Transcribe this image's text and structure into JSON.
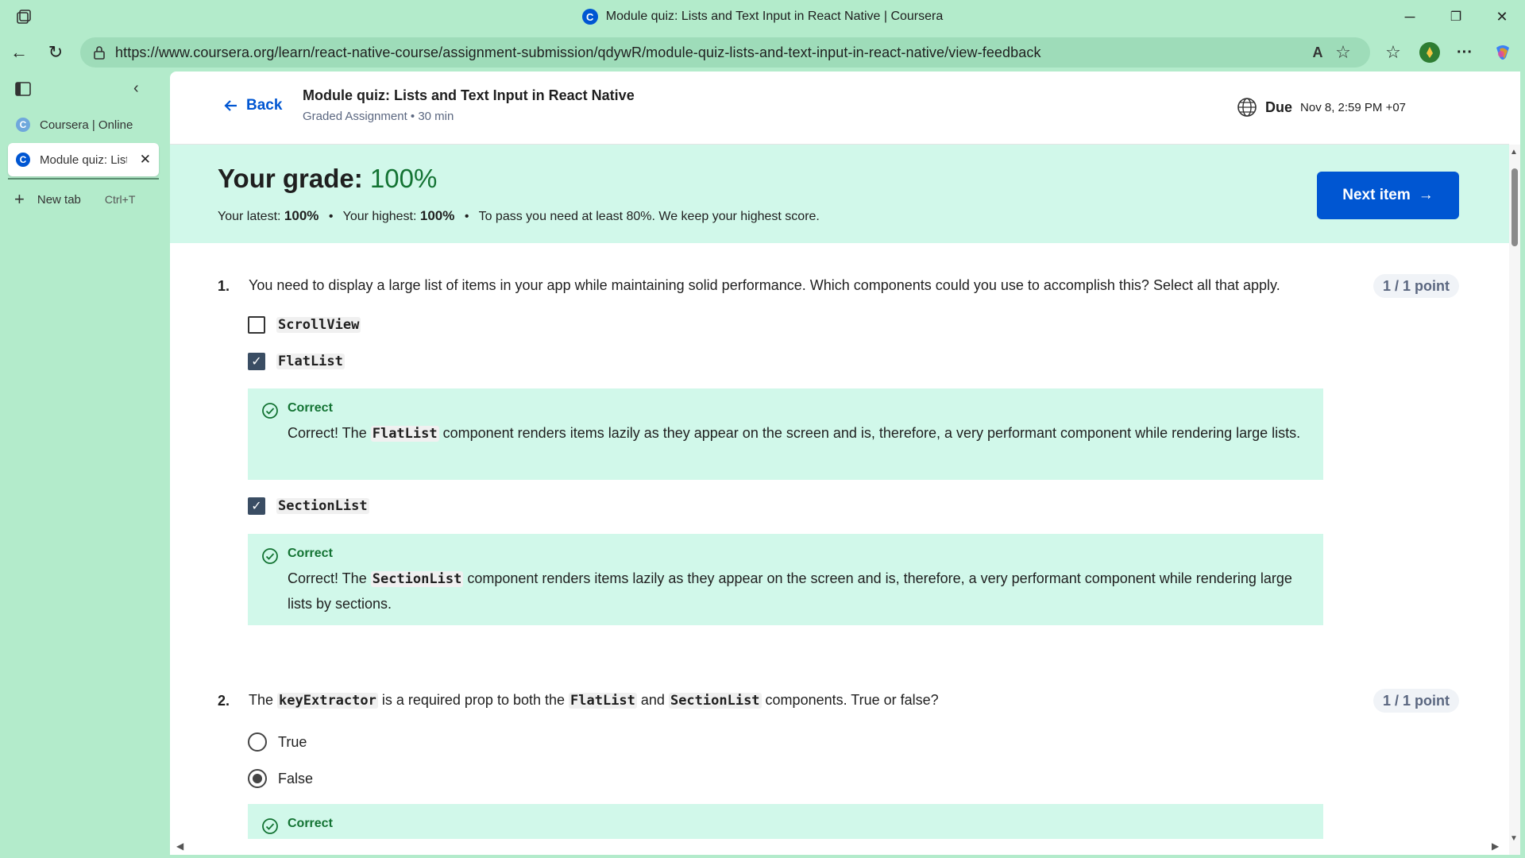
{
  "window": {
    "title": "Module quiz: Lists and Text Input in React Native | Coursera",
    "favicon_letter": "C",
    "controls": {
      "minimize": "─",
      "maximize": "❐",
      "close": "✕"
    }
  },
  "nav": {
    "back": "←",
    "reload": "↻",
    "url": "https://www.coursera.org/learn/react-native-course/assignment-submission/qdywR/module-quiz-lists-and-text-input-in-react-native/view-feedback",
    "read_aloud": "A",
    "favorite": "☆",
    "favorites_bar": "☆",
    "more": "···"
  },
  "sidebar": {
    "collapse": "‹",
    "tabs": [
      {
        "label": "Coursera | Online Co",
        "favicon": "C"
      },
      {
        "label": "Module quiz: List",
        "favicon": "C",
        "close": "✕"
      }
    ],
    "new_tab": {
      "label": "New tab",
      "shortcut": "Ctrl+T",
      "plus": "+"
    }
  },
  "header": {
    "back_label": "Back",
    "title": "Module quiz: Lists and Text Input in React Native",
    "subtitle": "Graded Assignment • 30 min",
    "due_label": "Due",
    "due_date": "Nov 8, 2:59 PM +07"
  },
  "grade": {
    "title_prefix": "Your grade: ",
    "value": "100%",
    "latest_label": "Your latest: ",
    "latest_value": "100%",
    "highest_label": "Your highest: ",
    "highest_value": "100%",
    "bullet": "•",
    "pass_text": "To pass you need at least 80%. We keep your highest score.",
    "next_button": "Next item",
    "next_arrow": "→"
  },
  "questions": [
    {
      "number": "1.",
      "text": "You need to display a large list of items in your app while maintaining solid performance. Which components could you use to accomplish this? Select all that apply.",
      "points": "1 / 1 point",
      "options": [
        {
          "label": "ScrollView",
          "checked": false
        },
        {
          "label": "FlatList",
          "checked": true
        },
        {
          "label": "SectionList",
          "checked": true
        }
      ],
      "feedback": [
        {
          "title": "Correct",
          "pre": "Correct! The ",
          "code": "FlatList",
          "post": " component renders items lazily as they appear on the screen and is, therefore, a very performant component while rendering large lists."
        },
        {
          "title": "Correct",
          "pre": "Correct! The ",
          "code": "SectionList",
          "post": " component renders items lazily as they appear on the screen and is, therefore, a very performant component while rendering large lists by sections."
        }
      ]
    },
    {
      "number": "2.",
      "text_parts": [
        "The ",
        "keyExtractor",
        " is a required prop to both the ",
        "FlatList",
        " and ",
        "SectionList",
        " components. True or false?"
      ],
      "points": "1 / 1 point",
      "options": [
        {
          "label": "True",
          "selected": false
        },
        {
          "label": "False",
          "selected": true
        }
      ],
      "feedback": [
        {
          "title": "Correct"
        }
      ]
    }
  ],
  "colors": {
    "accent": "#0056d2",
    "success": "#137333",
    "feedback_bg": "#d1f8ea",
    "browser_bg": "#b3ebcb"
  }
}
